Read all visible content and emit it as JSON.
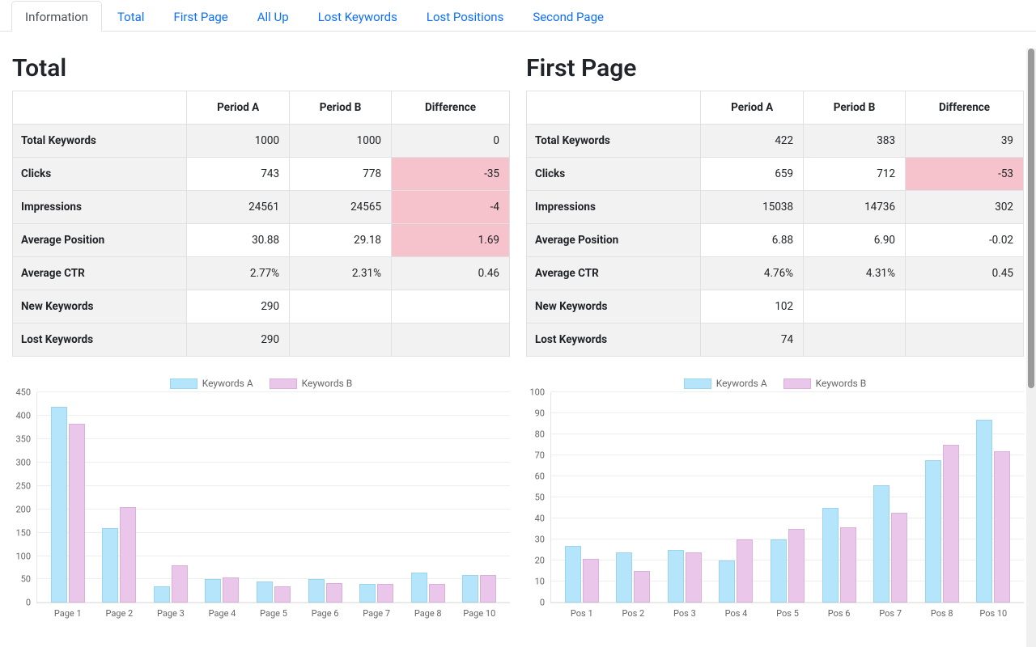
{
  "tabs": [
    "Information",
    "Total",
    "First Page",
    "All Up",
    "Lost Keywords",
    "Lost Positions",
    "Second Page"
  ],
  "active_tab": 0,
  "headers": [
    "",
    "Period A",
    "Period B",
    "Difference"
  ],
  "rows_labels": [
    "Total Keywords",
    "Clicks",
    "Impressions",
    "Average Position",
    "Average CTR",
    "New Keywords",
    "Lost Keywords"
  ],
  "legend": {
    "a": "Keywords A",
    "b": "Keywords B"
  },
  "panels": [
    {
      "title": "Total",
      "rows": [
        {
          "a": "1000",
          "b": "1000",
          "d": "0",
          "neg": false
        },
        {
          "a": "743",
          "b": "778",
          "d": "-35",
          "neg": true
        },
        {
          "a": "24561",
          "b": "24565",
          "d": "-4",
          "neg": true
        },
        {
          "a": "30.88",
          "b": "29.18",
          "d": "1.69",
          "neg": true
        },
        {
          "a": "2.77%",
          "b": "2.31%",
          "d": "0.46",
          "neg": false
        },
        {
          "a": "290",
          "b": "",
          "d": "",
          "neg": false
        },
        {
          "a": "290",
          "b": "",
          "d": "",
          "neg": false
        }
      ],
      "chart": {
        "ymax": 450,
        "ticks": [
          0,
          50,
          100,
          150,
          200,
          250,
          300,
          350,
          400,
          450
        ],
        "categories": [
          "Page 1",
          "Page 2",
          "Page 3",
          "Page 4",
          "Page 5",
          "Page 6",
          "Page 7",
          "Page 8",
          "Page 10"
        ],
        "series_a": [
          420,
          160,
          35,
          50,
          46,
          50,
          40,
          65,
          60
        ],
        "series_b": [
          383,
          205,
          80,
          55,
          35,
          42,
          40,
          40,
          60
        ]
      }
    },
    {
      "title": "First Page",
      "rows": [
        {
          "a": "422",
          "b": "383",
          "d": "39",
          "neg": false
        },
        {
          "a": "659",
          "b": "712",
          "d": "-53",
          "neg": true
        },
        {
          "a": "15038",
          "b": "14736",
          "d": "302",
          "neg": false
        },
        {
          "a": "6.88",
          "b": "6.90",
          "d": "-0.02",
          "neg": false
        },
        {
          "a": "4.76%",
          "b": "4.31%",
          "d": "0.45",
          "neg": false
        },
        {
          "a": "102",
          "b": "",
          "d": "",
          "neg": false
        },
        {
          "a": "74",
          "b": "",
          "d": "",
          "neg": false
        }
      ],
      "chart": {
        "ymax": 100,
        "ticks": [
          0,
          10,
          20,
          30,
          40,
          50,
          60,
          70,
          80,
          90,
          100
        ],
        "categories": [
          "Pos 1",
          "Pos 2",
          "Pos 3",
          "Pos 4",
          "Pos 5",
          "Pos 6",
          "Pos 7",
          "Pos 8",
          "Pos 10"
        ],
        "series_a": [
          27,
          24,
          25,
          20,
          30,
          45,
          56,
          68,
          87
        ],
        "series_b": [
          21,
          15,
          24,
          30,
          35,
          36,
          43,
          75,
          72
        ]
      }
    }
  ],
  "chart_data": [
    {
      "type": "bar",
      "title": "Total",
      "categories": [
        "Page 1",
        "Page 2",
        "Page 3",
        "Page 4",
        "Page 5",
        "Page 6",
        "Page 7",
        "Page 8",
        "Page 10"
      ],
      "series": [
        {
          "name": "Keywords A",
          "values": [
            420,
            160,
            35,
            50,
            46,
            50,
            40,
            65,
            60
          ]
        },
        {
          "name": "Keywords B",
          "values": [
            383,
            205,
            80,
            55,
            35,
            42,
            40,
            40,
            60
          ]
        }
      ],
      "ylim": [
        0,
        450
      ]
    },
    {
      "type": "bar",
      "title": "First Page",
      "categories": [
        "Pos 1",
        "Pos 2",
        "Pos 3",
        "Pos 4",
        "Pos 5",
        "Pos 6",
        "Pos 7",
        "Pos 8",
        "Pos 10"
      ],
      "series": [
        {
          "name": "Keywords A",
          "values": [
            27,
            24,
            25,
            20,
            30,
            45,
            56,
            68,
            87
          ]
        },
        {
          "name": "Keywords B",
          "values": [
            21,
            15,
            24,
            30,
            35,
            36,
            43,
            75,
            72
          ]
        }
      ],
      "ylim": [
        0,
        100
      ]
    }
  ]
}
